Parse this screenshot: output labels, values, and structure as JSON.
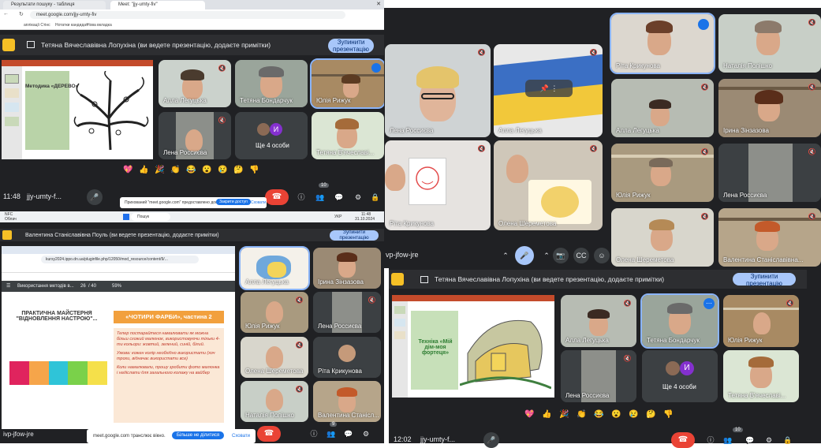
{
  "browser": {
    "tabs": [
      {
        "label": "Результати пошуку - таблиця"
      },
      {
        "label": "Meet: \"jjy-umty-fiv\""
      }
    ],
    "url": "meet.google.com/jjy-umty-fiv",
    "bookmarks": [
      "аплікації Стінс",
      "Нотатки кандидат",
      "Нова вкладка"
    ]
  },
  "q1": {
    "presenter_text": "Тетяна Вячеславівна Лопухіна (ви ведете презентацію, додаєте примітки)",
    "stop_label": "Зупинити презентацію",
    "slide_title": "Методика «ДЕРЕВО»",
    "tiles": [
      {
        "name": "Алла Легуцька"
      },
      {
        "name": "Тетяна Бондарчук"
      },
      {
        "name": "Юлія Рижук"
      },
      {
        "name": "Лена Россиєва"
      },
      {
        "name": "Ще 4 особи"
      },
      {
        "name": "Тетяна В'ячеславі..."
      }
    ],
    "more_initial": "И",
    "time": "11:48",
    "meeting_code": "jjy-umty-f...",
    "participants_count": "10",
    "share_notice": "Прихований \"meet.google.com\" предоставлено доступ к екр.",
    "share_stop": "Закрити доступ",
    "share_hide": "Сховати",
    "taskbar_search": "Пошук",
    "taskbar_weather": "NFC",
    "taskbar_weather_sub": "Облач",
    "taskbar_lang": "УКР",
    "taskbar_time": "11:48",
    "taskbar_date": "31.10.2024"
  },
  "q2": {
    "tiles": [
      {
        "name": "Лена Россиєва"
      },
      {
        "name": "Алла Легуцька"
      },
      {
        "name": "Ріта Крикунова"
      },
      {
        "name": "Наталія Полішко"
      },
      {
        "name": "Алла Легуцька"
      },
      {
        "name": "Ірина Зінзазова"
      },
      {
        "name": "Ріта Крикунова"
      },
      {
        "name": "Олена Шереметова"
      },
      {
        "name": "Юлія Рижук"
      },
      {
        "name": "Лена Россиєва"
      },
      {
        "name": "Олена Шереметова"
      },
      {
        "name": "Валентина Станіславівна..."
      }
    ],
    "meeting_code": "vp-jfow-jre"
  },
  "q3": {
    "presenter_text": "Валентина Станіславівна Поуль (ви ведете презентацію, додаєте примітки)",
    "stop_label": "Зупинити презентацію",
    "url": "kursy2024.ippo.dn.ua/pluginfile.php/12050/mod_resource/content/9/...",
    "doc_name": "Використання методів в...",
    "page": "26",
    "page_total": "/ 40",
    "zoom": "59%",
    "slide_title_left": "ПРАКТИЧНА МАЙСТЕРНЯ \"ВІДНОВЛЕННЯ НАСТРОЮ\"...",
    "slide_heading": "«ЧОТИРИ ФАРБИ», частина 2",
    "bullet1": "Тепер постарайтеся намалювати як можна більш схожий малюнок, використовуючи тільки 4-ти кольори: жовтий, зелений, синій, білий.",
    "bullet2": "Умова: кожен колір необхідно використати (хоч трохи, відначає використати все)",
    "bullet3": "Коли намалювали, прошу зробити фото малюнка і надіслати для загального колажу на вайбер",
    "tiles": [
      {
        "name": "Алла Легуцька"
      },
      {
        "name": "Ірина Зінзазова"
      },
      {
        "name": "Юлія Рижук"
      },
      {
        "name": "Лена Россиєва"
      },
      {
        "name": "Олена Шереметова"
      },
      {
        "name": "Ріта Крикунова"
      },
      {
        "name": "Наталія Полішко"
      },
      {
        "name": "Валентина Станісл..."
      }
    ],
    "meeting_code": "ivp-jfow-jre",
    "share_notice": "meet.google.com транслює вікно.",
    "share_stop": "Більше не ділитися",
    "share_hide": "Сховати",
    "participants_count": "9"
  },
  "q4": {
    "presenter_text": "Тетяна Вячеславівна Лопухіна (ви ведете презентацію, додаєте примітки)",
    "stop_label": "Зупинити презентацію",
    "slide_title": "Техніка «Мій дім-моя фортеця»",
    "tiles": [
      {
        "name": "Алла Легуцька"
      },
      {
        "name": "Тетяна Бондарчук"
      },
      {
        "name": "Юлія Рижук"
      },
      {
        "name": "Лена Россиєва"
      },
      {
        "name": "Ще 4 особи"
      },
      {
        "name": "Тетяна В'ячеславі..."
      }
    ],
    "more_initial": "И",
    "time": "12:02",
    "meeting_code": "jjy-umty-f...",
    "participants_count": "10"
  },
  "emojis": [
    "💖",
    "👍",
    "🎉",
    "👏",
    "😂",
    "😮",
    "😢",
    "🤔",
    "👎"
  ],
  "colors": {
    "meet_bg": "#202124",
    "tile_bg": "#3c4043",
    "accent": "#a8c7fa",
    "end_call": "#ea4335",
    "slide_orange": "#f2a03d"
  }
}
